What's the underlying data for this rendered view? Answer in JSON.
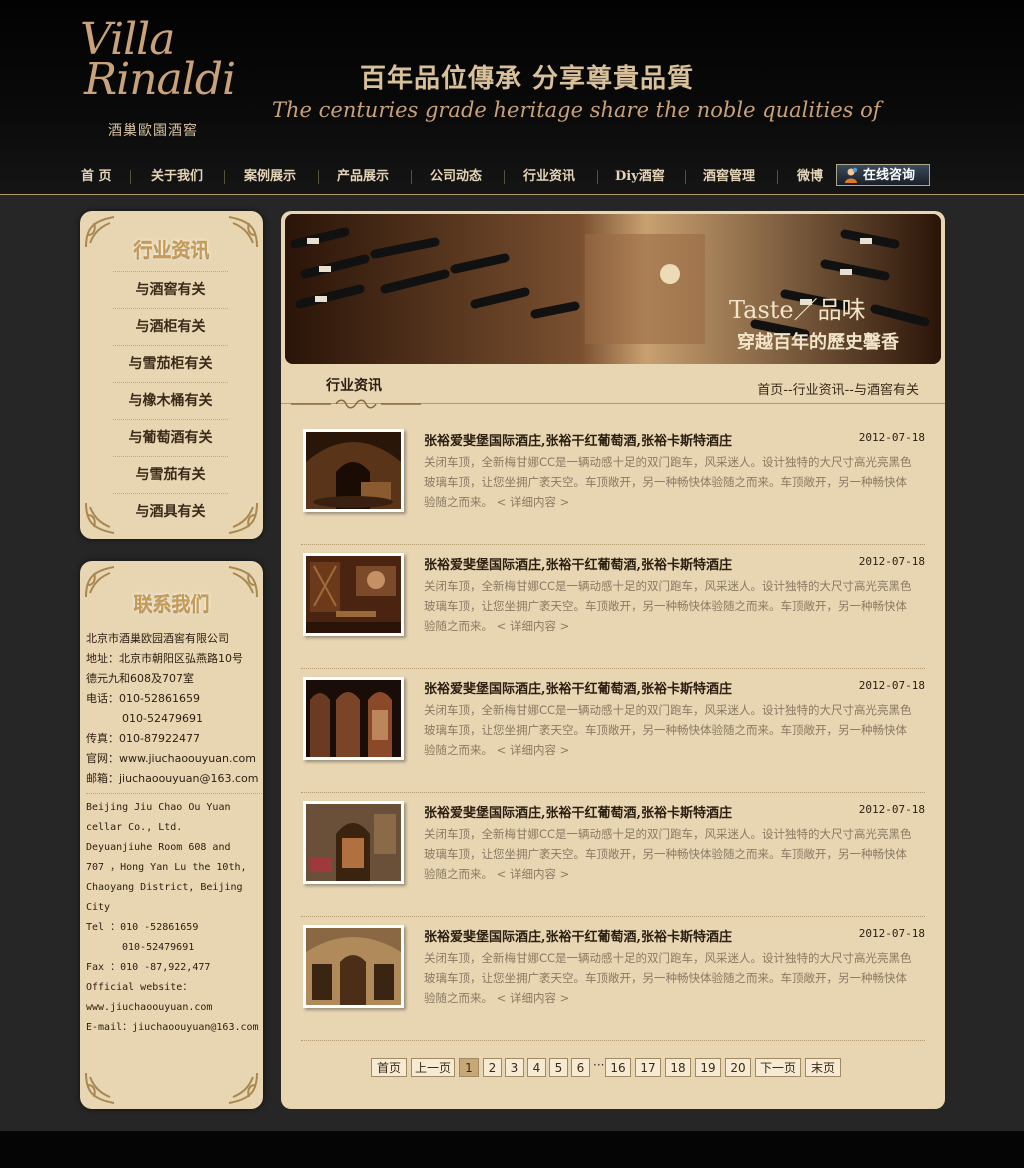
{
  "brand": {
    "logo_line1": "Villa",
    "logo_line2": "Rinaldi",
    "logo_cn": "酒巢歐園酒窖",
    "slogan_cn": "百年品位傳承 分享尊貴品質",
    "slogan_en": "The centuries grade heritage share the noble qualities of"
  },
  "nav": {
    "items": [
      "首 页",
      "关于我们",
      "案例展示",
      "产品展示",
      "公司动态",
      "行业资讯",
      "Diy酒窖",
      "酒窖管理",
      "微博"
    ],
    "consult_label": "在线咨询"
  },
  "sidebar": {
    "category_title": "行业资讯",
    "categories": [
      "与酒窖有关",
      "与酒柜有关",
      "与雪茄柜有关",
      "与橡木桶有关",
      "与葡萄酒有关",
      "与雪茄有关",
      "与酒具有关"
    ],
    "contact_title": "联系我们",
    "contact_cn": {
      "company": "北京市酒巢欧园酒窖有限公司",
      "address_1": "地址：北京市朝阳区弘燕路10号",
      "address_2": "德元九和608及707室",
      "phone_1": "电话：010-52861659",
      "phone_2": "010-52479691",
      "fax": "传真：010-87922477",
      "website": "官网：www.jiuchaoouyuan.com",
      "email": "邮箱：jiuchaoouyuan@163.com"
    },
    "contact_en": {
      "line1": "Beijing Jiu Chao Ou Yuan",
      "line2": "cellar Co., Ltd.",
      "line3": "Deyuanjiuhe Room 608 and",
      "line4": "707 ，Hong Yan Lu the 10th,",
      "line5": "Chaoyang District, Beijing",
      "line6": "City",
      "tel_1": "Tel ：010 -52861659",
      "tel_2": "010-52479691",
      "fax": "Fax ：010 -87,922,477",
      "website_label": "Official website：",
      "website": "www.jiuchaoouyuan.com",
      "email": "E-mail：jiuchaoouyuan@163.com"
    }
  },
  "banner": {
    "taste": "Taste／品味",
    "subtitle": "穿越百年的歷史馨香"
  },
  "main": {
    "section_title": "行业资讯",
    "breadcrumb": "首页--行业资讯--与酒窖有关",
    "articles": [
      {
        "title": "张裕爱斐堡国际酒庄,张裕干红葡萄酒,张裕卡斯特酒庄",
        "date": "2012-07-18",
        "body": "关闭车顶，全新梅甘娜CC是一辆动感十足的双门跑车，风采迷人。设计独特的大尺寸高光亮黑色玻璃车顶，让您坐拥广袤天空。车顶敞开，另一种畅快体验随之而来。车顶敞开，另一种畅快体验随之而来。",
        "more": "< 详细内容 >"
      },
      {
        "title": "张裕爱斐堡国际酒庄,张裕干红葡萄酒,张裕卡斯特酒庄",
        "date": "2012-07-18",
        "body": "关闭车顶，全新梅甘娜CC是一辆动感十足的双门跑车，风采迷人。设计独特的大尺寸高光亮黑色玻璃车顶，让您坐拥广袤天空。车顶敞开，另一种畅快体验随之而来。车顶敞开，另一种畅快体验随之而来。",
        "more": "< 详细内容 >"
      },
      {
        "title": "张裕爱斐堡国际酒庄,张裕干红葡萄酒,张裕卡斯特酒庄",
        "date": "2012-07-18",
        "body": "关闭车顶，全新梅甘娜CC是一辆动感十足的双门跑车，风采迷人。设计独特的大尺寸高光亮黑色玻璃车顶，让您坐拥广袤天空。车顶敞开，另一种畅快体验随之而来。车顶敞开，另一种畅快体验随之而来。",
        "more": "< 详细内容 >"
      },
      {
        "title": "张裕爱斐堡国际酒庄,张裕干红葡萄酒,张裕卡斯特酒庄",
        "date": "2012-07-18",
        "body": "关闭车顶，全新梅甘娜CC是一辆动感十足的双门跑车，风采迷人。设计独特的大尺寸高光亮黑色玻璃车顶，让您坐拥广袤天空。车顶敞开，另一种畅快体验随之而来。车顶敞开，另一种畅快体验随之而来。",
        "more": "< 详细内容 >"
      },
      {
        "title": "张裕爱斐堡国际酒庄,张裕干红葡萄酒,张裕卡斯特酒庄",
        "date": "2012-07-18",
        "body": "关闭车顶，全新梅甘娜CC是一辆动感十足的双门跑车，风采迷人。设计独特的大尺寸高光亮黑色玻璃车顶，让您坐拥广袤天空。车顶敞开，另一种畅快体验随之而来。车顶敞开，另一种畅快体验随之而来。",
        "more": "< 详细内容 >"
      }
    ]
  },
  "pager": {
    "first": "首页",
    "prev": "上一页",
    "pages_a": [
      "1",
      "2",
      "3",
      "4",
      "5",
      "6"
    ],
    "dots": "···",
    "pages_b": [
      "16",
      "17",
      "18",
      "19",
      "20"
    ],
    "next": "下一页",
    "last": "末页",
    "current": "1"
  },
  "colors": {
    "page_bg": "#262626",
    "panel_bg": "#e8d6b3",
    "gold": "#c9a27a",
    "text_dark": "#2a1e10",
    "text_muted": "#8a7a62"
  }
}
